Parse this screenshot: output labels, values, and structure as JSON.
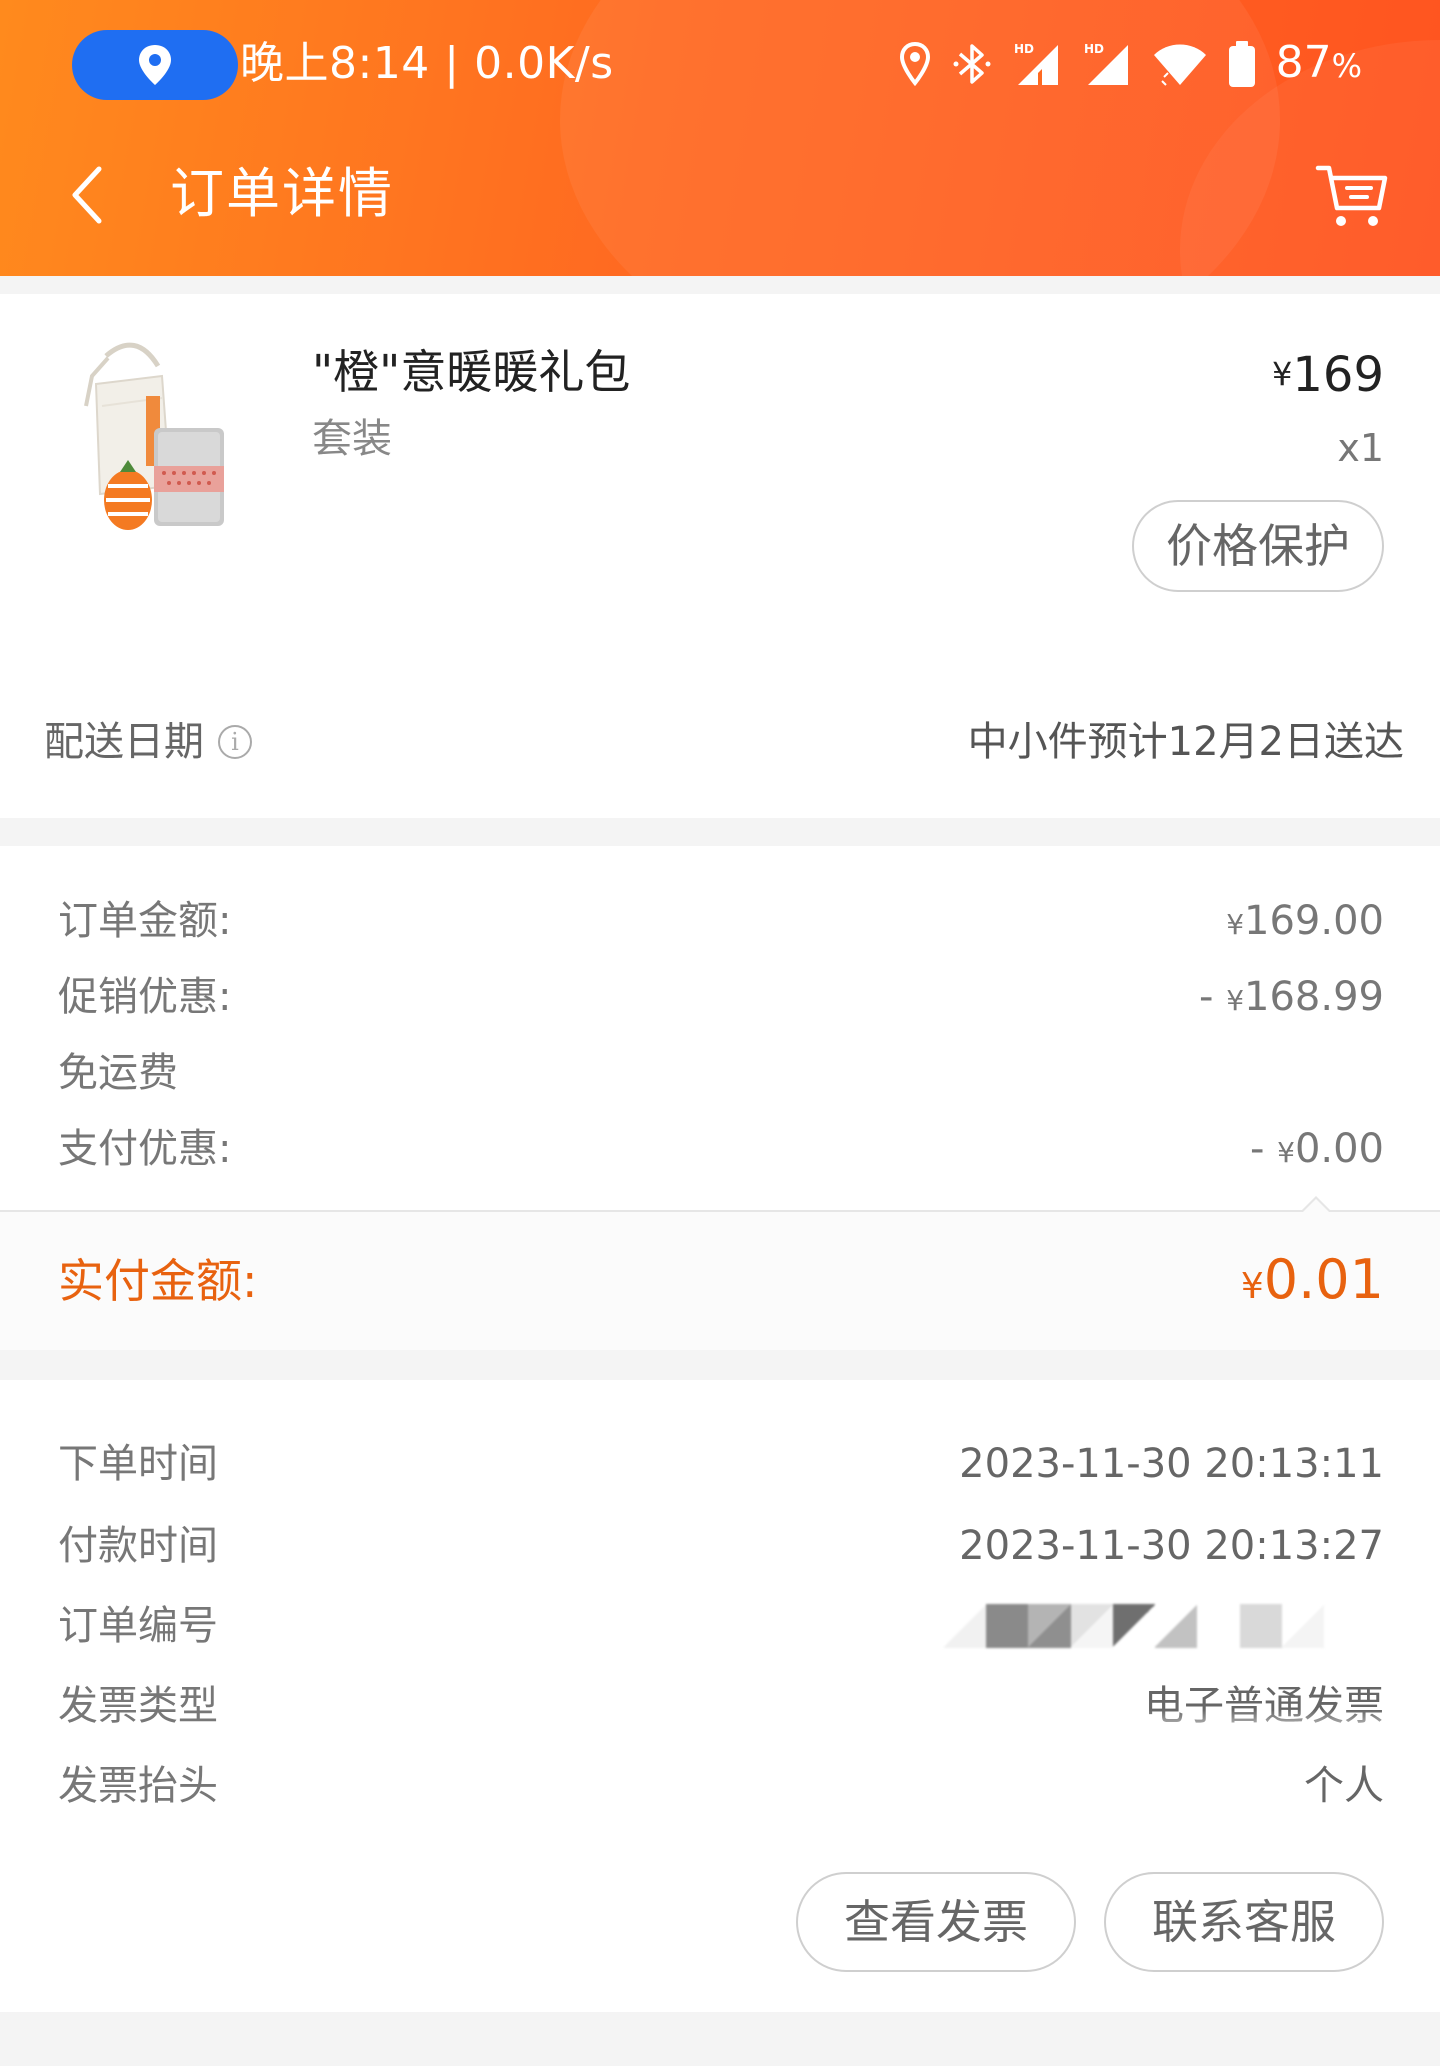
{
  "status_bar": {
    "time_text": "晚上8:14 | 0.0K/s",
    "battery": "87",
    "battery_unit": "%",
    "icons": [
      "location-icon",
      "bluetooth-icon",
      "hd-signal-icon",
      "hd-signal-icon",
      "wifi-icon",
      "battery-icon"
    ]
  },
  "header": {
    "title": "订单详情",
    "back_icon": "chevron-left-icon",
    "cart_icon": "cart-icon"
  },
  "product": {
    "name": "\"橙\"意暖暖礼包",
    "spec": "套装",
    "price_symbol": "¥",
    "price": "169",
    "quantity": "x1",
    "price_protect_label": "价格保护",
    "delivery_label": "配送日期",
    "delivery_value": "中小件预计12月2日送达"
  },
  "amounts": {
    "order_amount_label": "订单金额:",
    "order_amount_symbol": "¥",
    "order_amount_value": "169.00",
    "promo_label": "促销优惠:",
    "promo_prefix": "- ",
    "promo_symbol": "¥",
    "promo_value": "168.99",
    "free_shipping_label": "免运费",
    "payment_discount_label": "支付优惠:",
    "payment_discount_prefix": "- ",
    "payment_discount_symbol": "¥",
    "payment_discount_value": "0.00",
    "paid_label": "实付金额:",
    "paid_symbol": "¥",
    "paid_value": "0.01"
  },
  "order_info": {
    "order_time_label": "下单时间",
    "order_time_value": "2023-11-30 20:13:11",
    "pay_time_label": "付款时间",
    "pay_time_value": "2023-11-30 20:13:27",
    "order_no_label": "订单编号",
    "invoice_type_label": "发票类型",
    "invoice_type_value": "电子普通发票",
    "invoice_title_label": "发票抬头",
    "invoice_title_value": "个人"
  },
  "actions": {
    "view_invoice": "查看发票",
    "contact_service": "联系客服"
  },
  "colors": {
    "header_gradient_start": "#ff8a1d",
    "header_gradient_end": "#ff5420",
    "accent": "#e8620f",
    "location_pill": "#1f6ef2"
  }
}
